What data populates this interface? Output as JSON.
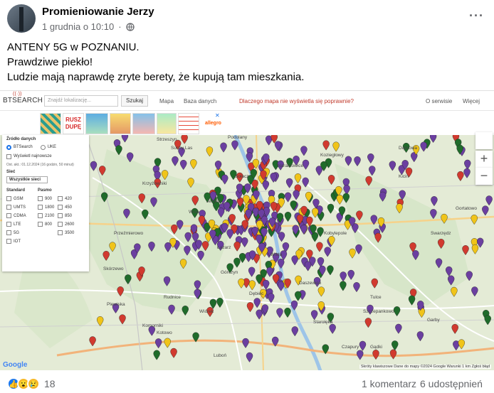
{
  "post": {
    "author": "Promieniowanie Jerzy",
    "date": "1 grudnia o 10:10",
    "separator": "·",
    "more": "···",
    "lines": [
      "ANTENY 5G w POZNANIU.",
      "Prawdziwe piekło!",
      "Ludzie mają naprawdę zryte berety, że kupują tam mieszkania."
    ]
  },
  "site": {
    "logo": "BTSEARCH",
    "search_placeholder": "Znajdź lokalizację...",
    "search_button": "Szukaj",
    "nav": [
      "Mapa",
      "Baza danych"
    ],
    "nav_warning": "Dlaczego mapa nie wyświetla się poprawnie?",
    "nav_right": [
      "O serwisie",
      "Więcej"
    ]
  },
  "ad": {
    "tile_text": "RUSZ DUPĘ",
    "brand": "allegro",
    "close": "✕"
  },
  "panel": {
    "source_title": "Źródło danych",
    "source_options": [
      "BTSearch",
      "UKE"
    ],
    "show_newest": "Wyświetl najnowsze",
    "updated": "Ost. akt.: 01.12.2024 (16 godzin, 50 minut)",
    "network_title": "Sieć",
    "network_select": "Wszystkie sieci",
    "standard_title": "Standard",
    "band_title": "Pasmo",
    "standards": [
      "GSM",
      "UMTS",
      "CDMA",
      "LTE",
      "5G",
      "IOT"
    ],
    "bands_a": [
      "900",
      "1800",
      "2100",
      "800"
    ],
    "bands_b": [
      "420",
      "450",
      "850",
      "2600",
      "3500"
    ]
  },
  "map": {
    "zoom_in": "+",
    "zoom_out": "−",
    "google": "Google",
    "attribution": "Skróty klawiszowe   Dane do mapy ©2024 Google   Warunki   1 km   Zgłoś błąd",
    "places": [
      "Strzeszyn",
      "Podolany",
      "Naramowice",
      "Wola",
      "Górczyn",
      "Sołacz",
      "Jeżyce",
      "Łazarz",
      "Wilda",
      "Dębiec",
      "Starołęka",
      "Swarzędz",
      "Luboń",
      "Komorniki",
      "Plewiska",
      "Skórzewo",
      "Suchy Las",
      "Koziegłowy",
      "Czapury",
      "Kicin",
      "Tulce",
      "Garby",
      "Gortatowo",
      "Rudnice",
      "Kotowo",
      "Przeźmierowo",
      "Krzyżowniki",
      "Gądki",
      "Dąbrowa",
      "Wiórek",
      "Daszewice",
      "Kobylepole",
      "Szczepankowo"
    ]
  },
  "footer": {
    "reactions": "18",
    "comments": "1 komentarz",
    "shares": "6 udostępnień"
  },
  "colors": {
    "accent": "#1a73e8",
    "pin_purple": "#6b3fa0",
    "pin_green": "#1f6b2a",
    "pin_red": "#d13a2f",
    "pin_yellow": "#f0c419"
  }
}
